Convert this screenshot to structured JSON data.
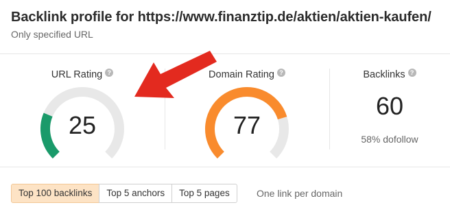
{
  "header": {
    "title": "Backlink profile for https://www.finanztip.de/aktien/aktien-kaufen/",
    "subtitle": "Only specified URL"
  },
  "metrics": {
    "url_rating": {
      "label": "URL Rating",
      "help": "?",
      "value": "25",
      "level": 25,
      "color": "#1a9a6a"
    },
    "domain_rating": {
      "label": "Domain Rating",
      "help": "?",
      "value": "77",
      "level": 77,
      "color": "#f98b2d"
    },
    "backlinks": {
      "label": "Backlinks",
      "help": "?",
      "value": "60",
      "sub": "58% dofollow"
    }
  },
  "gauge_track_color": "#e8e8e8",
  "tabs": [
    {
      "label": "Top 100 backlinks",
      "active": true
    },
    {
      "label": "Top 5 anchors",
      "active": false
    },
    {
      "label": "Top 5 pages",
      "active": false
    }
  ],
  "tabs_note": "One link per domain",
  "annotation": {
    "arrow_color": "#e32a1f"
  }
}
